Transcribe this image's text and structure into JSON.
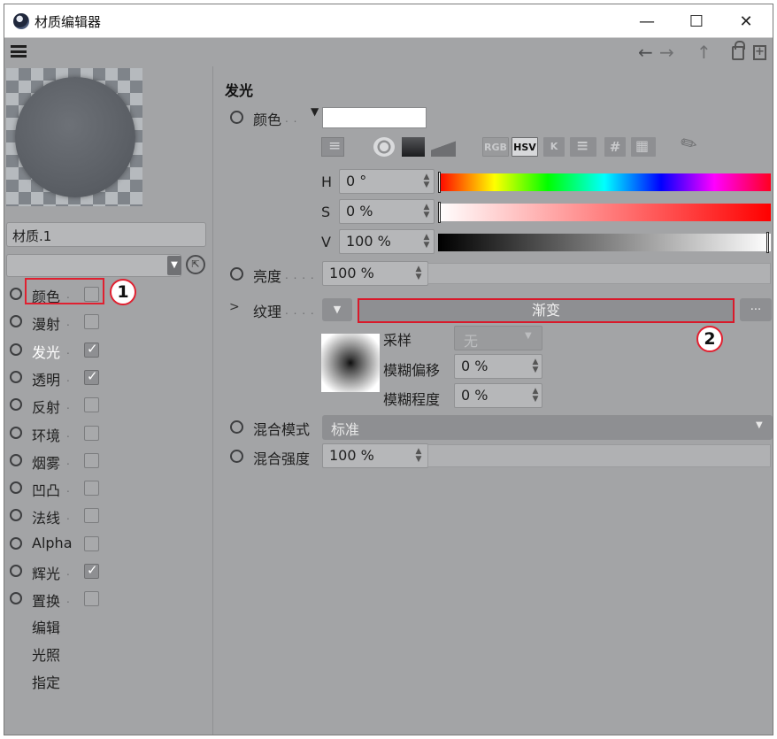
{
  "window": {
    "title": "材质编辑器",
    "controls": {
      "minimize": "—",
      "maximize": "☐",
      "close": "✕"
    }
  },
  "menubar": {
    "menu_icon": "hamburger-menu-icon",
    "nav": {
      "back": "←",
      "forward": "→",
      "up": "↑",
      "lock": "lock-icon",
      "new_window": "new-window-icon"
    }
  },
  "left_panel": {
    "material_name": "材质.1",
    "channels": [
      {
        "label": "颜色",
        "checked": false,
        "active": false
      },
      {
        "label": "漫射",
        "checked": false,
        "active": false
      },
      {
        "label": "发光",
        "checked": true,
        "active": true
      },
      {
        "label": "透明",
        "checked": true,
        "active": false
      },
      {
        "label": "反射",
        "checked": false,
        "active": false
      },
      {
        "label": "环境",
        "checked": false,
        "active": false
      },
      {
        "label": "烟雾",
        "checked": false,
        "active": false
      },
      {
        "label": "凹凸",
        "checked": false,
        "active": false
      },
      {
        "label": "法线",
        "checked": false,
        "active": false
      },
      {
        "label": "Alpha",
        "checked": false,
        "active": false
      },
      {
        "label": "辉光",
        "checked": true,
        "active": false
      },
      {
        "label": "置换",
        "checked": false,
        "active": false
      }
    ],
    "extra_items": [
      "编辑",
      "光照",
      "指定"
    ]
  },
  "right_panel": {
    "section_title": "发光",
    "color": {
      "label": "颜色",
      "swatch_color": "#ffffff",
      "tools": {
        "rgb": "RGB",
        "hsv": "HSV",
        "k": "K",
        "hash": "#"
      },
      "h_label": "H",
      "h_value": "0 °",
      "s_label": "S",
      "s_value": "0 %",
      "v_label": "V",
      "v_value": "100 %"
    },
    "brightness": {
      "label": "亮度",
      "value": "100 %"
    },
    "texture": {
      "label": "纹理",
      "value": "渐变",
      "more": "...",
      "sample_label": "采样",
      "sample_value": "无",
      "blur_offset_label": "模糊偏移",
      "blur_offset_value": "0 %",
      "blur_scale_label": "模糊程度",
      "blur_scale_value": "0 %"
    },
    "blend_mode": {
      "label": "混合模式",
      "value": "标准"
    },
    "blend_strength": {
      "label": "混合强度",
      "value": "100 %"
    }
  },
  "annotations": {
    "marker_1": "1",
    "marker_2": "2"
  },
  "colors": {
    "panel_bg": "#a3a4a6",
    "highlight": "#e02030",
    "active_text": "#ffffff"
  }
}
